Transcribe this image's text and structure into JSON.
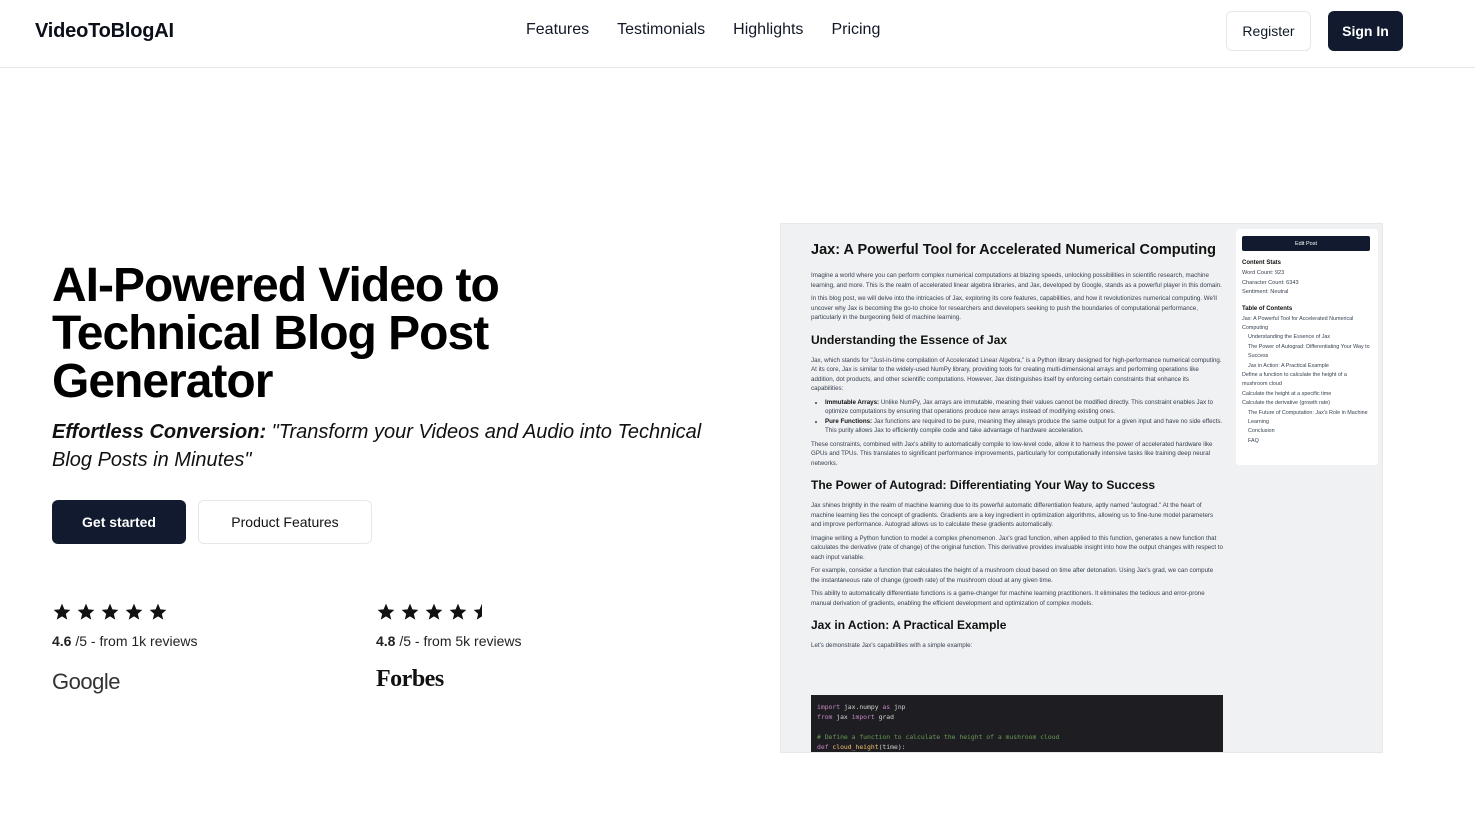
{
  "header": {
    "logo": "VideoToBlogAI",
    "nav": [
      "Features",
      "Testimonials",
      "Highlights",
      "Pricing"
    ],
    "register": "Register",
    "sign_in": "Sign In"
  },
  "hero": {
    "title": "AI-Powered Video to Technical Blog Post Generator",
    "subtitle_bold": "Effortless Conversion:",
    "subtitle_rest": " \"Transform your Videos and Audio into Technical Blog Posts in Minutes\"",
    "cta_primary": "Get started",
    "cta_secondary": "Product Features"
  },
  "ratings": [
    {
      "score": "4.6",
      "rest": " /5 - from 1k reviews",
      "stars": 5,
      "brand": "Google"
    },
    {
      "score": "4.8",
      "rest": " /5 - from 5k reviews",
      "stars": 4.5,
      "brand": "Forbes"
    }
  ],
  "preview": {
    "title": "Jax: A Powerful Tool for Accelerated Numerical Computing",
    "p1": "Imagine a world where you can perform complex numerical computations at blazing speeds, unlocking possibilities in scientific research, machine learning, and more. This is the realm of accelerated linear algebra libraries, and Jax, developed by Google, stands as a powerful player in this domain.",
    "p2": "In this blog post, we will delve into the intricacies of Jax, exploring its core features, capabilities, and how it revolutionizes numerical computing. We'll uncover why Jax is becoming the go-to choice for researchers and developers seeking to push the boundaries of computational performance, particularly in the burgeoning field of machine learning.",
    "h_essence": "Understanding the Essence of Jax",
    "p3": "Jax, which stands for \"Just-in-time compilation of Accelerated Linear Algebra,\" is a Python library designed for high-performance numerical computing. At its core, Jax is similar to the widely-used NumPy library, providing tools for creating multi-dimensional arrays and performing operations like addition, dot products, and other scientific computations. However, Jax distinguishes itself by enforcing certain constraints that enhance its capabilities:",
    "li1_b": "Immutable Arrays:",
    "li1": " Unlike NumPy, Jax arrays are immutable, meaning their values cannot be modified directly. This constraint enables Jax to optimize computations by ensuring that operations produce new arrays instead of modifying existing ones.",
    "li2_b": "Pure Functions:",
    "li2": " Jax functions are required to be pure, meaning they always produce the same output for a given input and have no side effects. This purity allows Jax to efficiently compile code and take advantage of hardware acceleration.",
    "p4": "These constraints, combined with Jax's ability to automatically compile to low-level code, allow it to harness the power of accelerated hardware like GPUs and TPUs. This translates to significant performance improvements, particularly for computationally intensive tasks like training deep neural networks.",
    "h_autograd": "The Power of Autograd: Differentiating Your Way to Success",
    "p5": "Jax shines brightly in the realm of machine learning due to its powerful automatic differentiation feature, aptly named \"autograd.\" At the heart of machine learning lies the concept of gradients. Gradients are a key ingredient in optimization algorithms, allowing us to fine-tune model parameters and improve performance. Autograd allows us to calculate these gradients automatically.",
    "p6": "Imagine writing a Python function to model a complex phenomenon. Jax's grad function, when applied to this function, generates a new function that calculates the derivative (rate of change) of the original function. This derivative provides invaluable insight into how the output changes with respect to each input variable.",
    "p7": "For example, consider a function that calculates the height of a mushroom cloud based on time after detonation. Using Jax's grad, we can compute the instantaneous rate of change (growth rate) of the mushroom cloud at any given time.",
    "p8": "This ability to automatically differentiate functions is a game-changer for machine learning practitioners. It eliminates the tedious and error-prone manual derivation of gradients, enabling the efficient development and optimization of complex models.",
    "h_action": "Jax in Action: A Practical Example",
    "p9": "Let's demonstrate Jax's capabilities with a simple example:",
    "code": {
      "l1_kw": "import",
      "l1": " jax.numpy ",
      "l1_as": "as",
      "l1_b": " jnp",
      "l2_kw": "from",
      "l2": " jax ",
      "l2_imp": "import",
      "l2_b": " grad",
      "l4": "# Define a function to calculate the height of a mushroom cloud",
      "l5_kw": "def",
      "l5_fn": " cloud_height",
      "l5": "(time):"
    },
    "sidebar": {
      "edit": "Edit Post",
      "stats_h": "Content Stats",
      "words": "Word Count: 923",
      "chars": "Character Count: 6343",
      "sentiment": "Sentiment: Neutral",
      "toc_h": "Table of Contents",
      "toc": [
        {
          "text": "Jax: A Powerful Tool for Accelerated Numerical Computing",
          "indent": false
        },
        {
          "text": "Understanding the Essence of Jax",
          "indent": true
        },
        {
          "text": "The Power of Autograd: Differentiating Your Way to Success",
          "indent": true
        },
        {
          "text": "Jax in Action: A Practical Example",
          "indent": true
        },
        {
          "text": "Define a function to calculate the height of a mushroom cloud",
          "indent": false
        },
        {
          "text": "Calculate the height at a specific time",
          "indent": false
        },
        {
          "text": "Calculate the derivative (growth rate)",
          "indent": false
        },
        {
          "text": "The Future of Computation: Jax's Role in Machine Learning",
          "indent": true
        },
        {
          "text": "Conclusion",
          "indent": true
        },
        {
          "text": "FAQ",
          "indent": true
        }
      ]
    }
  }
}
